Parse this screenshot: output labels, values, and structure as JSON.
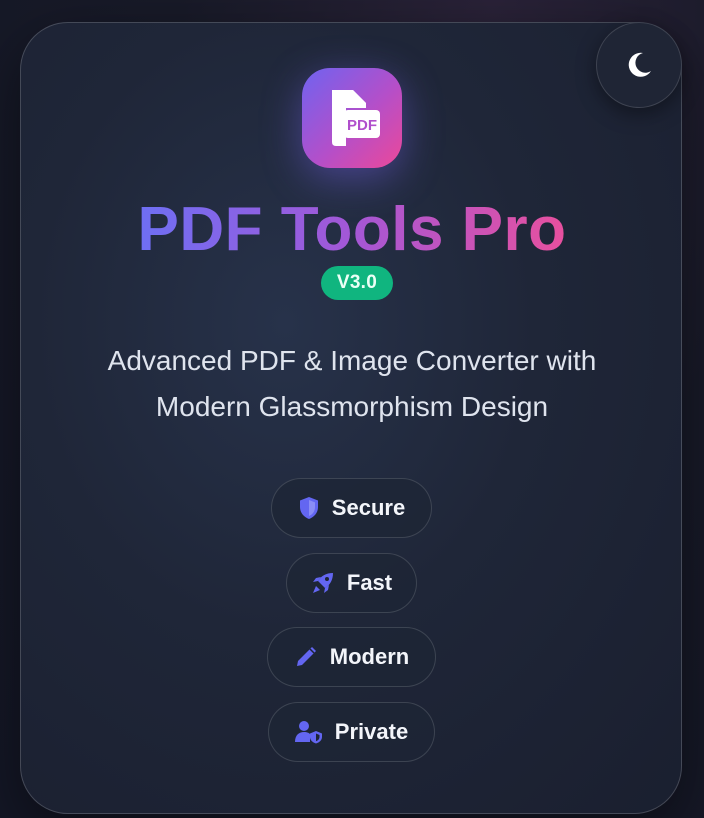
{
  "app": {
    "title": "PDF Tools Pro",
    "version": "V3.0",
    "subtitle_line1": "Advanced PDF & Image Converter with",
    "subtitle_line2": "Modern Glassmorphism Design",
    "logo_text": "PDF"
  },
  "features": [
    {
      "label": "Secure",
      "icon": "shield-icon"
    },
    {
      "label": "Fast",
      "icon": "rocket-icon"
    },
    {
      "label": "Modern",
      "icon": "pen-icon"
    },
    {
      "label": "Private",
      "icon": "user-shield-icon"
    }
  ],
  "theme_toggle": {
    "icon": "moon-icon"
  },
  "colors": {
    "accent": "#6366f1",
    "gradient_start": "#6e6ff4",
    "gradient_end": "#e8509e",
    "badge": "#10b57f"
  }
}
